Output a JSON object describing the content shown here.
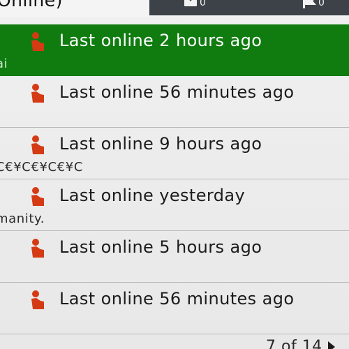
{
  "header": {
    "title": "Online)",
    "tabs": [
      {
        "icon": "messages-icon",
        "count": "0"
      },
      {
        "icon": "flag-icon",
        "count": "0"
      }
    ]
  },
  "friends": [
    {
      "status": "Last online 2 hours ago",
      "message": "ai",
      "selected": true
    },
    {
      "status": "Last online 56 minutes ago",
      "message": "",
      "selected": false
    },
    {
      "status": "Last online 9 hours ago",
      "message": "C€¥C€¥C€¥C",
      "selected": false
    },
    {
      "status": "Last online yesterday",
      "message": "manity.",
      "selected": false
    },
    {
      "status": "Last online 5 hours ago",
      "message": "",
      "selected": false
    },
    {
      "status": "Last online 56 minutes ago",
      "message": "",
      "selected": false
    }
  ],
  "presence_icon": "person-offline-icon",
  "colors": {
    "selected_row": "#107c10",
    "presence": "#d43b14",
    "tabbar": "#3d4248"
  },
  "pager": {
    "label": "7 of 14"
  }
}
